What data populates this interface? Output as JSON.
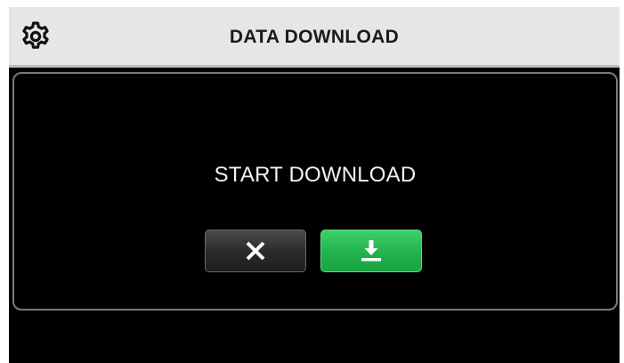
{
  "header": {
    "title": "DATA DOWNLOAD",
    "settings_icon": "gear-icon"
  },
  "dialog": {
    "message": "START DOWNLOAD",
    "cancel_icon": "close-icon",
    "confirm_icon": "download-icon"
  },
  "colors": {
    "header_bg": "#e6e6e6",
    "screen_bg": "#000000",
    "confirm_green": "#23b24d",
    "cancel_dark": "#2a2a2a"
  }
}
